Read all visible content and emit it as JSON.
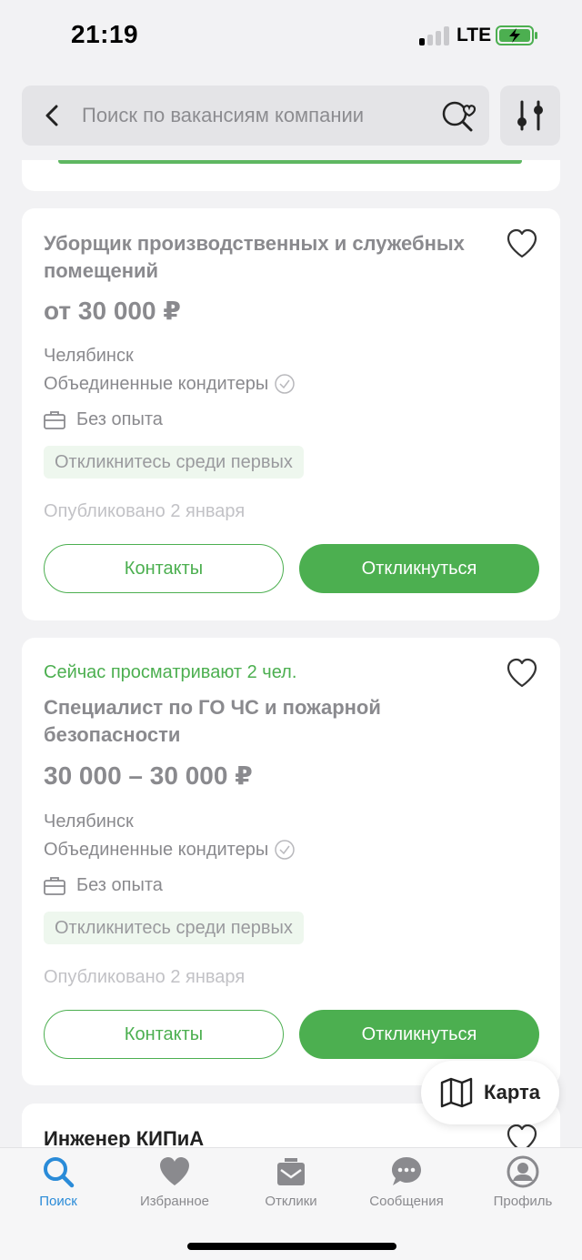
{
  "status_bar": {
    "time": "21:19",
    "network": "LTE"
  },
  "header": {
    "search_placeholder": "Поиск по вакансиям компании"
  },
  "vacancies": [
    {
      "title": "Уборщик производственных и служебных помещений",
      "salary": "от 30 000 ₽",
      "city": "Челябинск",
      "company": "Объединенные кондитеры",
      "experience": "Без опыта",
      "badge": "Откликнитесь среди первых",
      "published": "Опубликовано 2 января",
      "contacts_label": "Контакты",
      "apply_label": "Откликнуться"
    },
    {
      "viewing_now": "Сейчас просматривают 2 чел.",
      "title": "Специалист по ГО ЧС и пожарной безопасности",
      "salary": "30 000 – 30 000 ₽",
      "city": "Челябинск",
      "company": "Объединенные кондитеры",
      "experience": "Без опыта",
      "badge": "Откликнитесь среди первых",
      "published": "Опубликовано 2 января",
      "contacts_label": "Контакты",
      "apply_label": "Откликнуться"
    },
    {
      "title": "Инженер КИПиА"
    }
  ],
  "map_button": {
    "label": "Карта"
  },
  "nav": [
    {
      "label": "Поиск",
      "icon": "search-icon",
      "active": true
    },
    {
      "label": "Избранное",
      "icon": "heart-icon"
    },
    {
      "label": "Отклики",
      "icon": "responses-icon"
    },
    {
      "label": "Сообщения",
      "icon": "messages-icon"
    },
    {
      "label": "Профиль",
      "icon": "profile-icon"
    }
  ],
  "colors": {
    "accent_green": "#4caf50",
    "active_blue": "#2a8bd8",
    "background": "#f2f2f4"
  }
}
